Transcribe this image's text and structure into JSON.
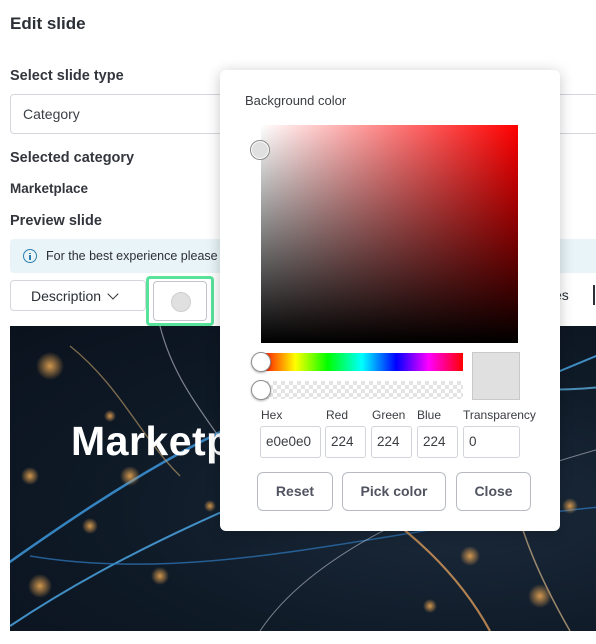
{
  "page": {
    "title": "Edit slide",
    "select_type_label": "Select slide type",
    "slide_type_value": "Category",
    "selected_category_label": "Selected category",
    "selected_category_value": "Marketplace",
    "preview_label": "Preview slide",
    "info_text": "For the best experience please",
    "description_dropdown": "Description",
    "toolbar_tail_text": "es",
    "slide_heading": "Marketp"
  },
  "color_picker": {
    "title": "Background color",
    "current_color": "#e0e0e0",
    "hue_position": 0,
    "transparency_position": 0,
    "labels": {
      "hex": "Hex",
      "red": "Red",
      "green": "Green",
      "blue": "Blue",
      "transparency": "Transparency"
    },
    "values": {
      "hex": "e0e0e0",
      "red": "224",
      "green": "224",
      "blue": "224",
      "transparency": "0"
    },
    "buttons": {
      "reset": "Reset",
      "pick": "Pick color",
      "close": "Close"
    }
  },
  "colors": {
    "accent_highlight": "#58e39a",
    "info_background": "#e8f4f8",
    "info_icon": "#2d7fb0"
  },
  "icons": [
    "info-icon",
    "chevron-down-icon"
  ]
}
